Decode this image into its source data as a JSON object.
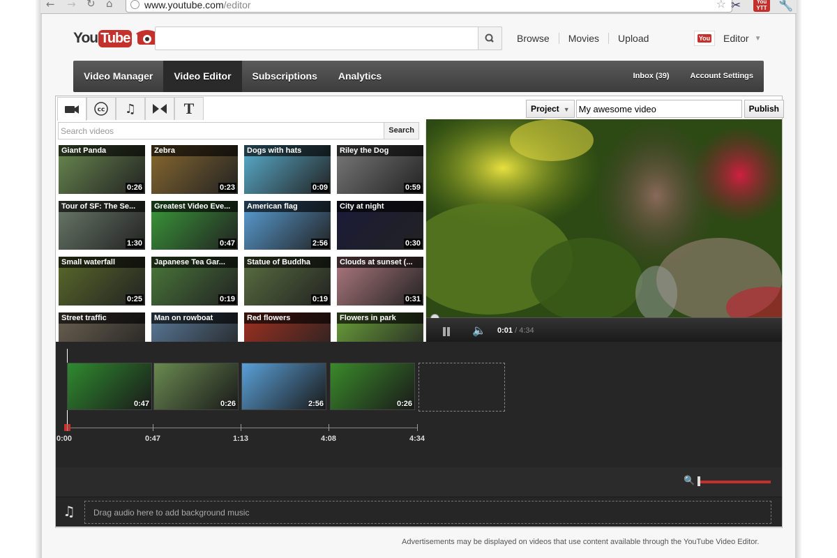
{
  "browser": {
    "url_host": "www.youtube.com",
    "url_path": "/editor",
    "nav_icons": [
      "back-arrow-icon",
      "forward-arrow-icon",
      "reload-icon",
      "home-icon"
    ],
    "tool_icons": [
      "bookmark-star-icon",
      "scissors-icon",
      "youtube-extension-icon",
      "wrench-icon"
    ],
    "extension_badge": "You\nYTT"
  },
  "header": {
    "logo_you": "You",
    "logo_tube": "Tube",
    "search_placeholder": "",
    "links": [
      "Browse",
      "Movies",
      "Upload"
    ],
    "user_avatar_text": "YouTube",
    "user_name": "Editor"
  },
  "tabs": {
    "left": [
      "Video Manager",
      "Video Editor",
      "Subscriptions",
      "Analytics"
    ],
    "active": "Video Editor",
    "right": [
      "Inbox (39)",
      "Account Settings"
    ]
  },
  "editor": {
    "tool_tabs": [
      "video-camera-icon",
      "closed-caption-icon",
      "music-note-icon",
      "transition-icon",
      "text-icon"
    ],
    "project_label": "Project",
    "project_name": "My awesome video",
    "publish_label": "Publish",
    "search_placeholder": "Search videos",
    "search_button": "Search",
    "videos": [
      {
        "title": "Giant Panda",
        "duration": "0:26",
        "color": "#6a8a50"
      },
      {
        "title": "Zebra",
        "duration": "0:23",
        "color": "#8a6a30"
      },
      {
        "title": "Dogs with hats",
        "duration": "0:09",
        "color": "#5ab0d0"
      },
      {
        "title": "Riley the Dog",
        "duration": "0:59",
        "color": "#7a7a7a"
      },
      {
        "title": "Tour of SF: The Se...",
        "duration": "1:30",
        "color": "#6a7a6a"
      },
      {
        "title": "Greatest Video Eve...",
        "duration": "0:47",
        "color": "#3a9a3a"
      },
      {
        "title": "American flag",
        "duration": "2:56",
        "color": "#5aa0d8"
      },
      {
        "title": "City at night",
        "duration": "0:30",
        "color": "#1a1a3a"
      },
      {
        "title": "Small waterfall",
        "duration": "0:25",
        "color": "#5a6a2a"
      },
      {
        "title": "Japanese Tea Gar...",
        "duration": "0:19",
        "color": "#4a7a3a"
      },
      {
        "title": "Statue of Buddha",
        "duration": "0:19",
        "color": "#5a7040"
      },
      {
        "title": "Clouds at sunset (...",
        "duration": "0:31",
        "color": "#b07a80"
      },
      {
        "title": "Street traffic",
        "duration": "",
        "color": "#6a6050"
      },
      {
        "title": "Man on rowboat",
        "duration": "",
        "color": "#5a7a9a"
      },
      {
        "title": "Red flowers",
        "duration": "",
        "color": "#a03020"
      },
      {
        "title": "Flowers in park",
        "duration": "",
        "color": "#6aa03a"
      }
    ]
  },
  "player": {
    "current_time": "0:01",
    "separator": " / ",
    "total_time": "4:34",
    "progress": 0.004
  },
  "timeline": {
    "clips": [
      {
        "duration": "0:47",
        "color": "#2f8a2f"
      },
      {
        "duration": "0:26",
        "color": "#6a8a50"
      },
      {
        "duration": "2:56",
        "color": "#5aa0d8"
      },
      {
        "duration": "0:26",
        "color": "#3a8a2a"
      }
    ],
    "markers": [
      "0:00",
      "0:47",
      "1:13",
      "4:08",
      "4:34"
    ],
    "zoom_level": 1.0,
    "audio_drop_text": "Drag audio here to add background music"
  },
  "footer": {
    "text": "Advertisements may be displayed on videos that use content available through the YouTube Video Editor."
  }
}
